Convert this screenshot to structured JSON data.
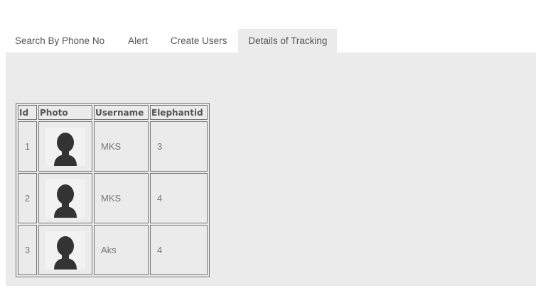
{
  "tabs": [
    {
      "label": "Search By Phone No",
      "active": false
    },
    {
      "label": "Alert",
      "active": false
    },
    {
      "label": "Create Users",
      "active": false
    },
    {
      "label": "Details of Tracking",
      "active": true
    }
  ],
  "table": {
    "headers": {
      "id": "Id",
      "photo": "Photo",
      "username": "Username",
      "elephantid": "Elephantid"
    },
    "rows": [
      {
        "id": "1",
        "photo_icon": "user-silhouette-icon",
        "username": "MKS",
        "elephantid": "3"
      },
      {
        "id": "2",
        "photo_icon": "user-silhouette-icon",
        "username": "MKS",
        "elephantid": "4"
      },
      {
        "id": "3",
        "photo_icon": "user-silhouette-icon",
        "username": "Aks",
        "elephantid": "4"
      }
    ]
  },
  "colors": {
    "panel_background": "#ebebeb",
    "text": "#555555",
    "avatar": "#333333"
  }
}
